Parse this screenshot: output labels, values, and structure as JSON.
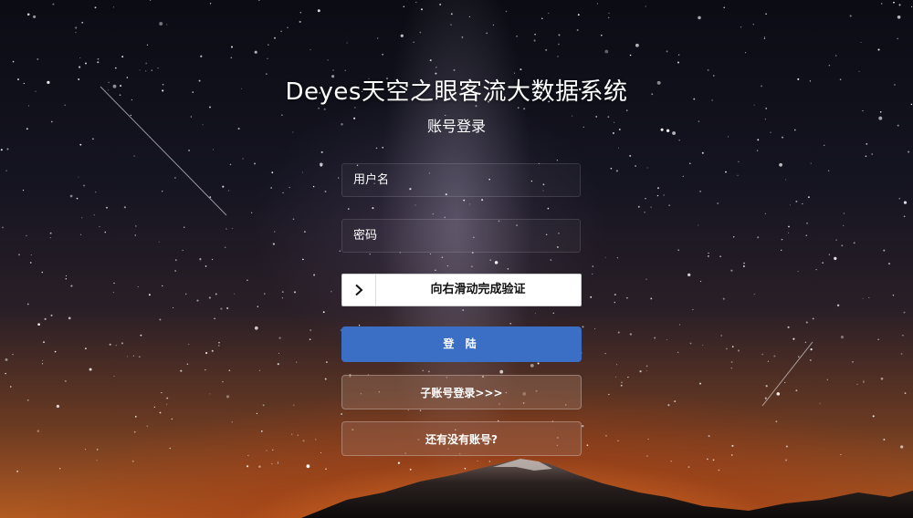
{
  "title": "Deyes天空之眼客流大数据系统",
  "subtitle": "账号登录",
  "form": {
    "username_placeholder": "用户名",
    "username_value": "",
    "password_placeholder": "密码",
    "password_value": ""
  },
  "slider": {
    "text": "向右滑动完成验证",
    "handle_icon": "chevron-right-icon"
  },
  "buttons": {
    "login": "登 陆",
    "sub_account": "子账号登录>>>",
    "no_account": "还有没有账号?"
  },
  "colors": {
    "login_button": "#3b6fc6",
    "secondary_button": "#96705a",
    "text": "#ffffff"
  }
}
